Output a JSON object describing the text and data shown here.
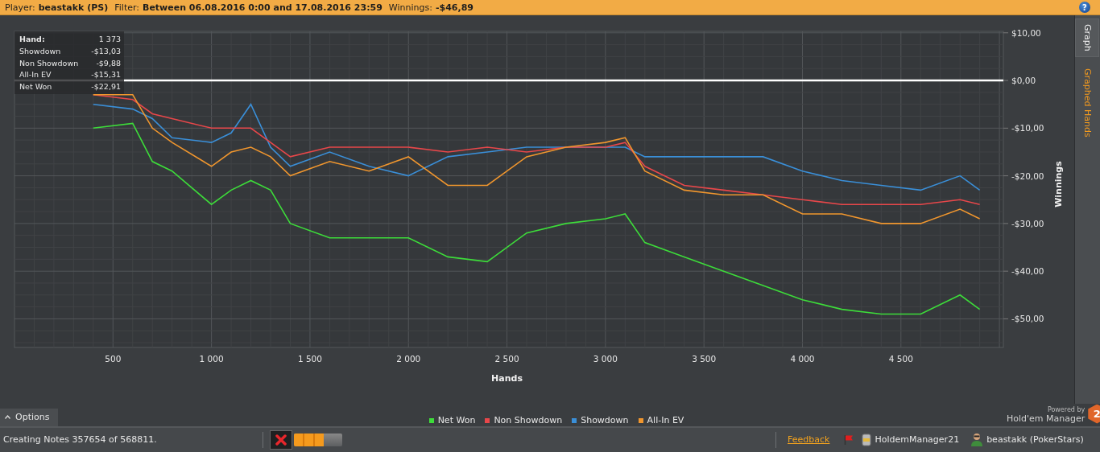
{
  "header": {
    "player_label": "Player:",
    "player": "beastakk (PS)",
    "filter_label": "Filter:",
    "filter": "Between 06.08.2016 0:00 and 17.08.2016 23:59",
    "winnings_label": "Winnings:",
    "winnings": "-$46,89",
    "help": "?"
  },
  "side_tabs": [
    {
      "label": "Graph",
      "selected": true
    },
    {
      "label": "Graphed Hands",
      "selected": false
    }
  ],
  "graph": {
    "tooltip": [
      {
        "label": "Hand:",
        "value": "1 373"
      },
      {
        "label": "Showdown",
        "value": "-$13,03"
      },
      {
        "label": "Non Showdown",
        "value": "-$9,88"
      },
      {
        "label": "All-In EV",
        "value": "-$15,31"
      },
      {
        "label": "Net Won",
        "value": "-$22,91"
      }
    ],
    "chart_data": {
      "type": "line",
      "xlabel": "Hands",
      "ylabel": "Winnings",
      "grid": true,
      "xlim": [
        0,
        5020
      ],
      "ylim": [
        -56,
        10.3
      ],
      "xticks": [
        {
          "value": 500,
          "label": "500"
        },
        {
          "value": 1000,
          "label": "1 000"
        },
        {
          "value": 1500,
          "label": "1 500"
        },
        {
          "value": 2000,
          "label": "2 000"
        },
        {
          "value": 2500,
          "label": "2 500"
        },
        {
          "value": 3000,
          "label": "3 000"
        },
        {
          "value": 3500,
          "label": "3 500"
        },
        {
          "value": 4000,
          "label": "4 000"
        },
        {
          "value": 4500,
          "label": "4 500"
        }
      ],
      "yticks": [
        {
          "value": 10,
          "label": "$10,00"
        },
        {
          "value": 0,
          "label": "$0,00"
        },
        {
          "value": -10,
          "label": "-$10,00"
        },
        {
          "value": -20,
          "label": "-$20,00"
        },
        {
          "value": -30,
          "label": "-$30,00"
        },
        {
          "value": -40,
          "label": "-$40,00"
        },
        {
          "value": -50,
          "label": "-$50,00"
        }
      ],
      "x": [
        400,
        600,
        700,
        800,
        1000,
        1100,
        1200,
        1300,
        1400,
        1600,
        1800,
        2000,
        2200,
        2400,
        2600,
        2800,
        3000,
        3100,
        3200,
        3400,
        3600,
        3800,
        4000,
        4200,
        4400,
        4600,
        4800,
        4900
      ],
      "series": [
        {
          "name": "Net Won",
          "color": "#3ddc3a",
          "values": [
            -10,
            -9,
            -17,
            -19,
            -26,
            -23,
            -21,
            -23,
            -30,
            -33,
            -33,
            -33,
            -37,
            -38,
            -32,
            -30,
            -29,
            -28,
            -34,
            -37,
            -40,
            -43,
            -46,
            -48,
            -49,
            -49,
            -45,
            -48
          ]
        },
        {
          "name": "Non Showdown",
          "color": "#e8474a",
          "values": [
            -3,
            -4,
            -7,
            -8,
            -10,
            -10,
            -10,
            -13,
            -16,
            -14,
            -14,
            -14,
            -15,
            -14,
            -15,
            -14,
            -14,
            -13,
            -18,
            -22,
            -23,
            -24,
            -25,
            -26,
            -26,
            -26,
            -25,
            -26
          ]
        },
        {
          "name": "Showdown",
          "color": "#3a8fd8",
          "values": [
            -5,
            -6,
            -8,
            -12,
            -13,
            -11,
            -5,
            -14,
            -18,
            -15,
            -18,
            -20,
            -16,
            -15,
            -14,
            -14,
            -14,
            -14,
            -16,
            -16,
            -16,
            -16,
            -19,
            -21,
            -22,
            -23,
            -20,
            -23
          ]
        },
        {
          "name": "All-In EV",
          "color": "#f0962e",
          "values": [
            -3,
            -3,
            -10,
            -13,
            -18,
            -15,
            -14,
            -16,
            -20,
            -17,
            -19,
            -16,
            -22,
            -22,
            -16,
            -14,
            -13,
            -12,
            -19,
            -23,
            -24,
            -24,
            -28,
            -28,
            -30,
            -30,
            -27,
            -29
          ]
        }
      ]
    }
  },
  "options_button": "Options",
  "branding": {
    "powered_by": "Powered by",
    "product": "Hold'em Manager",
    "version": "2"
  },
  "status_bar": {
    "message": "Creating Notes 357654 of 568811.",
    "progress": {
      "level": 0.62
    },
    "feedback_link": "Feedback",
    "database": "HoldemManager21",
    "user": "beastakk (PokerStars)"
  }
}
